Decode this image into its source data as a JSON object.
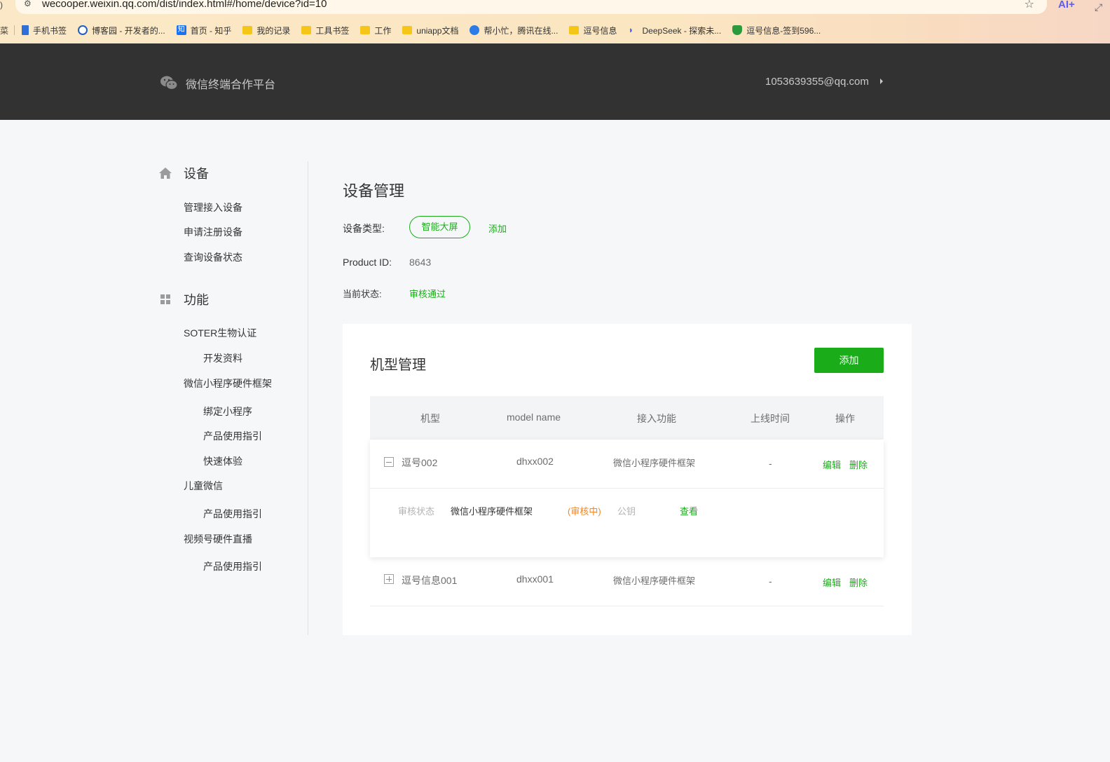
{
  "browser": {
    "url": "wecooper.weixin.qq.com/dist/index.html#/home/device?id=10",
    "ai_label": "AI+",
    "bookmarks": [
      {
        "label": "手机书签",
        "icon": "phone-icon"
      },
      {
        "label": "博客园 - 开发者的...",
        "icon": "blog-icon"
      },
      {
        "label": "首页 - 知乎",
        "icon": "zhihu-icon"
      },
      {
        "label": "我的记录",
        "icon": "folder-icon"
      },
      {
        "label": "工具书签",
        "icon": "folder-icon"
      },
      {
        "label": "工作",
        "icon": "folder-icon"
      },
      {
        "label": "uniapp文档",
        "icon": "folder-icon"
      },
      {
        "label": "帮小忙，腾讯在线...",
        "icon": "cloud-icon"
      },
      {
        "label": "逗号信息",
        "icon": "folder-icon"
      },
      {
        "label": "DeepSeek - 探索未...",
        "icon": "deepseek-icon"
      },
      {
        "label": "逗号信息-签到596...",
        "icon": "shield-icon"
      }
    ]
  },
  "header": {
    "logo_text": "微信终端合作平台",
    "account": "1053639355@qq.com"
  },
  "sidebar": {
    "device_section": "设备",
    "device_items": [
      "管理接入设备",
      "申请注册设备",
      "查询设备状态"
    ],
    "feature_section": "功能",
    "feature_items": [
      "SOTER生物认证",
      "开发资料",
      "微信小程序硬件框架",
      "绑定小程序",
      "产品使用指引",
      "快速体验",
      "儿童微信",
      "产品使用指引",
      "视频号硬件直播",
      "产品使用指引"
    ]
  },
  "main": {
    "title": "设备管理",
    "device_type_label": "设备类型:",
    "device_type_value": "智能大屏",
    "device_type_add": "添加",
    "product_id_label": "Product ID:",
    "product_id_value": "8643",
    "status_label": "当前状态:",
    "status_value": "审核通过"
  },
  "model_card": {
    "title": "机型管理",
    "add_button": "添加",
    "columns": [
      "机型",
      "model name",
      "接入功能",
      "上线时间",
      "操作"
    ],
    "rows": [
      {
        "model": "逗号002",
        "model_name": "dhxx002",
        "feature": "微信小程序硬件框架",
        "online_time": "-",
        "edit": "编辑",
        "delete": "删除",
        "detail": {
          "review_label": "审核状态",
          "feature": "微信小程序硬件框架",
          "review_status": "(审核中)",
          "key_label": "公钥",
          "view": "查看"
        }
      },
      {
        "model": "逗号信息001",
        "model_name": "dhxx001",
        "feature": "微信小程序硬件框架",
        "online_time": "-",
        "edit": "编辑",
        "delete": "删除"
      }
    ]
  },
  "colors": {
    "brand_green": "#1aad19",
    "header_dark": "#323232",
    "review_orange": "#f0882a"
  }
}
